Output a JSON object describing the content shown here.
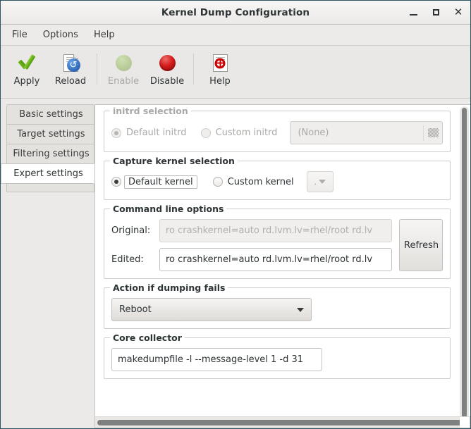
{
  "window": {
    "title": "Kernel Dump Configuration",
    "buttons": {
      "minimize": "minimize",
      "maximize": "maximize",
      "close": "close"
    }
  },
  "menubar": {
    "items": [
      {
        "label": "File"
      },
      {
        "label": "Options"
      },
      {
        "label": "Help"
      }
    ]
  },
  "toolbar": {
    "items": [
      {
        "label": "Apply",
        "icon": "green-check-icon",
        "enabled": true
      },
      {
        "label": "Reload",
        "icon": "document-reload-icon",
        "enabled": true
      },
      {
        "label": "Enable",
        "icon": "green-circle-icon",
        "enabled": false
      },
      {
        "label": "Disable",
        "icon": "red-circle-icon",
        "enabled": true
      },
      {
        "label": "Help",
        "icon": "document-lifering-icon",
        "enabled": true
      }
    ]
  },
  "tabs": {
    "items": [
      {
        "label": "Basic settings",
        "active": false
      },
      {
        "label": "Target settings",
        "active": false
      },
      {
        "label": "Filtering settings",
        "active": false
      },
      {
        "label": "Expert settings",
        "active": true
      }
    ]
  },
  "groups": {
    "initrd": {
      "legend": "initrd selection",
      "enabled": false,
      "default_radio": "Default initrd",
      "custom_radio": "Custom initrd",
      "file_value": "(None)",
      "file_icon": "folder-icon"
    },
    "capture_kernel": {
      "legend": "Capture kernel selection",
      "default_radio": "Default kernel",
      "custom_radio": "Custom kernel",
      "combo_value": ","
    },
    "command_line": {
      "legend": "Command line options",
      "original_label": "Original:",
      "original_value": "ro crashkernel=auto rd.lvm.lv=rhel/root rd.lv",
      "edited_label": "Edited:",
      "edited_value": "ro crashkernel=auto rd.lvm.lv=rhel/root rd.lv",
      "refresh_label": "Refresh"
    },
    "action_fail": {
      "legend": "Action if dumping fails",
      "selected": "Reboot"
    },
    "core_collector": {
      "legend": "Core collector",
      "value": "makedumpfile -l --message-level 1 -d 31"
    }
  },
  "colors": {
    "window_bg": "#eceae8",
    "content_bg": "#ffffff",
    "accent_green": "#4e9a06",
    "accent_red": "#cc0000",
    "accent_blue": "#2a62b4",
    "border": "#c6c4c0",
    "scrollbar_thumb": "#7f8180"
  }
}
